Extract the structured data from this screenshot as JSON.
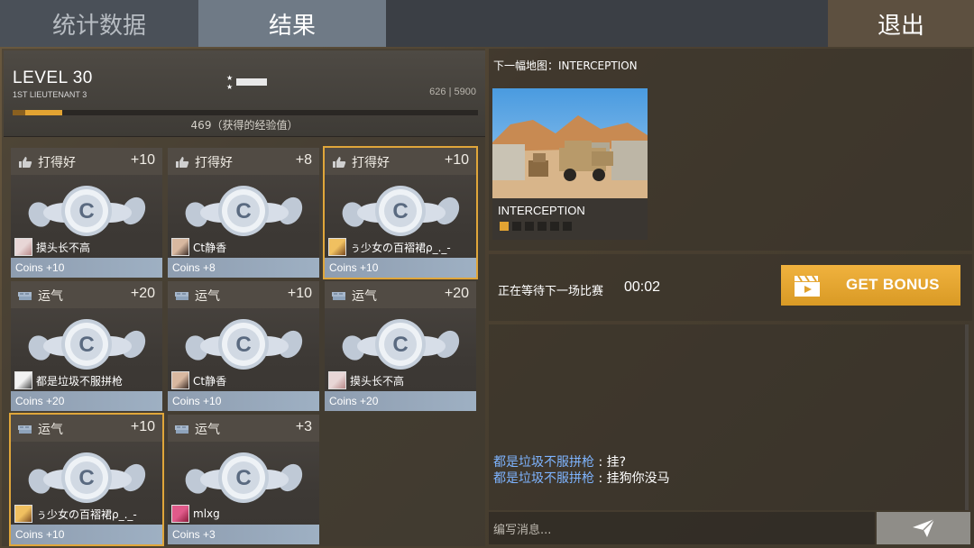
{
  "tabs": {
    "stats": "统计数据",
    "results": "结果"
  },
  "exit_label": "退出",
  "level": {
    "title": "LEVEL 30",
    "rank": "1ST LIEUTENANT 3",
    "xp_current": "626",
    "xp_sep": "|",
    "xp_max": "5900",
    "xp_progress": 0.106,
    "xp_gained": "469（获得的经验值）"
  },
  "cards": [
    {
      "category": "打得好",
      "points": "+10",
      "player": "摸头长不高",
      "footer": "Coins +10",
      "icon": "thumbs-up-icon",
      "avatar": "avatar-1",
      "highlight": false
    },
    {
      "category": "打得好",
      "points": "+8",
      "player": "Ct静香",
      "footer": "Coins +8",
      "icon": "thumbs-up-icon",
      "avatar": "avatar-2",
      "highlight": false
    },
    {
      "category": "打得好",
      "points": "+10",
      "player": "ぅ少女の百褶裙ρ_._-",
      "footer": "Coins +10",
      "icon": "thumbs-up-icon",
      "avatar": "avatar-3",
      "highlight": true
    },
    {
      "category": "运气",
      "points": "+20",
      "player": "都是垃圾不服拼枪",
      "footer": "Coins +20",
      "icon": "luck-icon",
      "avatar": "avatar-4",
      "highlight": false
    },
    {
      "category": "运气",
      "points": "+10",
      "player": "Ct静香",
      "footer": "Coins +10",
      "icon": "luck-icon",
      "avatar": "avatar-2",
      "highlight": false
    },
    {
      "category": "运气",
      "points": "+20",
      "player": "摸头长不高",
      "footer": "Coins +20",
      "icon": "luck-icon",
      "avatar": "avatar-1",
      "highlight": false
    },
    {
      "category": "运气",
      "points": "+10",
      "player": "ぅ少女の百褶裙ρ_._-",
      "footer": "Coins +10",
      "icon": "luck-icon",
      "avatar": "avatar-3",
      "highlight": true
    },
    {
      "category": "运气",
      "points": "+3",
      "player": "mlxg",
      "footer": "Coins +3",
      "icon": "luck-icon",
      "avatar": "avatar-5",
      "highlight": false
    }
  ],
  "next_map": {
    "label": "下一幅地图：INTERCEPTION",
    "name": "INTERCEPTION",
    "dots_total": 6,
    "dots_active": 1
  },
  "waiting": {
    "text": "正在等待下一场比赛",
    "timer": "00:02"
  },
  "bonus_label": "GET BONUS",
  "chat": {
    "messages": [
      {
        "from": "都是垃圾不服拼枪",
        "sep": " : ",
        "text": "挂?"
      },
      {
        "from": "都是垃圾不服拼枪",
        "sep": " : ",
        "text": "挂狗你没马"
      }
    ],
    "placeholder": "编写消息..."
  },
  "colors": {
    "accent": "#e2a332",
    "chat_name": "#7eb4ff",
    "card_footer": "#9eb0c3"
  }
}
